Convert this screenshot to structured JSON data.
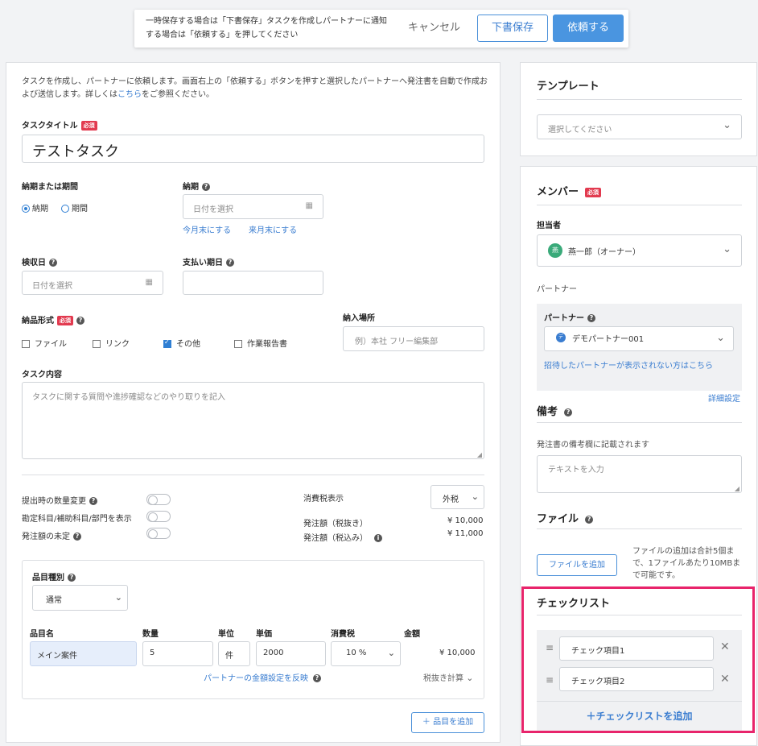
{
  "topbar": {
    "note": "一時保存する場合は「下書保存」タスクを作成しパートナーに通知する場合は「依頼する」を押してください",
    "cancel": "キャンセル",
    "draft": "下書保存",
    "submit": "依頼する"
  },
  "main": {
    "intro_text": "タスクを作成し、パートナーに依頼します。画面右上の「依頼する」ボタンを押すと選択したパートナーへ発注書を自動で作成および送信します。詳しくは",
    "intro_link": "こちら",
    "intro_tail": "をご参照ください。",
    "required_badge": "必須",
    "title_label": "タスクタイトル",
    "title_value": "テストタスク",
    "due_type_label": "納期または期間",
    "radio_due": "納期",
    "radio_period": "期間",
    "due_label": "納期",
    "date_placeholder": "日付を選択",
    "this_month_end": "今月末にする",
    "next_month_end": "来月末にする",
    "inspection_label": "検収日",
    "payment_label": "支払い期日",
    "delivery_format_label": "納品形式",
    "formats": [
      "ファイル",
      "リンク",
      "その他",
      "作業報告書"
    ],
    "delivery_place_label": "納入場所",
    "delivery_place_placeholder": "例）本社 フリー編集部",
    "content_label": "タスク内容",
    "content_placeholder": "タスクに関する質問や進捗確認などのやり取りを記入",
    "toggle_qty_change": "提出時の数量変更",
    "toggle_account": "勘定科目/補助科目/部門を表示",
    "toggle_undecided": "発注額の未定",
    "tax_display_label": "消費税表示",
    "tax_display_value": "外税",
    "amount_ex_label": "発注額（税抜き）",
    "amount_ex_value": "¥ 10,000",
    "amount_in_label": "発注額（税込み）",
    "amount_in_value": "¥ 11,000"
  },
  "items": {
    "type_label": "品目種別",
    "type_value": "通常",
    "headers": {
      "name": "品目名",
      "qty": "数量",
      "unit": "単位",
      "price": "単価",
      "tax": "消費税",
      "amount": "金額"
    },
    "row": {
      "name": "メイン案件",
      "qty": "5",
      "unit": "件",
      "price": "2000",
      "tax": "10 %",
      "amount": "¥ 10,000"
    },
    "reflect_link": "パートナーの金額設定を反映",
    "tax_calc": "税抜き計算",
    "add_item": "品目を追加"
  },
  "sidebar": {
    "template_title": "テンプレート",
    "template_placeholder": "選択してください",
    "member_title": "メンバー",
    "assignee_label": "担当者",
    "assignee_avatar": "燕",
    "assignee_value": "燕一郎（オーナー）",
    "partner_section_label": "パートナー",
    "partner_label": "パートナー",
    "partner_avatar": "デ",
    "partner_value": "デモパートナー001",
    "partner_missing_link": "招待したパートナーが表示されない方はこちら",
    "detail_settings": "詳細設定",
    "remarks_title": "備考",
    "remarks_desc": "発注書の備考欄に記載されます",
    "remarks_placeholder": "テキストを入力",
    "file_title": "ファイル",
    "file_button": "ファイルを追加",
    "file_note": "ファイルの追加は合計5個まで、1ファイルあたり10MBまで可能です。",
    "checklist_title": "チェックリスト",
    "checklist_items": [
      "チェック項目1",
      "チェック項目2"
    ],
    "checklist_add": "チェックリストを追加"
  },
  "colors": {
    "accent": "#4a95e0",
    "required": "#e23a4f",
    "highlight": "#e8246b",
    "avatar": "#3aaa7a"
  }
}
